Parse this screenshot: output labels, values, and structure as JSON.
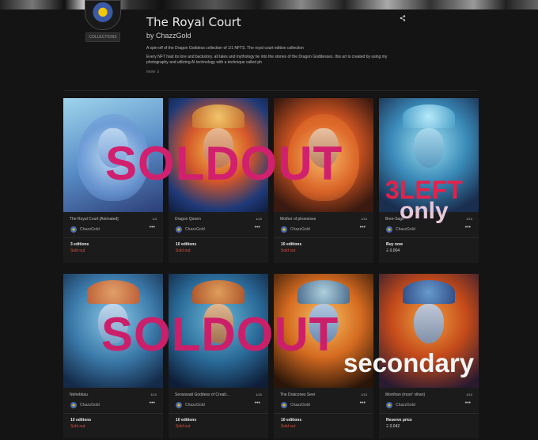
{
  "header": {
    "collections_label": "COLLECTIONS",
    "title": "The Royal Court",
    "byline": "by ChazzGold",
    "share_icon": "share-icon",
    "description_line1": "A spin-off of the Dragon Goddess collection of 1/1 NFTS. The royal court edition collection",
    "description_line2": "Every NFT hast its lore and backstory. all tales and mythology tie into the stories of the Dragon Goddesses. this art is created by using my photography and utilizing AI technology with a technique called ph",
    "more_label": "more ⇓"
  },
  "cards": [
    {
      "name": "The Royal Court [Animated]",
      "count": "1/3",
      "creator": "ChazzGold",
      "editions": "3 editions",
      "status": "Sold out",
      "status_kind": "sold"
    },
    {
      "name": "Dragon Queen",
      "count": "1/10",
      "creator": "ChazzGold",
      "editions": "10 editions",
      "status": "Sold out",
      "status_kind": "sold"
    },
    {
      "name": "Mother of phoenixes",
      "count": "1/10",
      "creator": "ChazzGold",
      "editions": "10 editions",
      "status": "Sold out",
      "status_kind": "sold"
    },
    {
      "name": "Bree-Sagh",
      "count": "1/10",
      "creator": "ChazzGold",
      "editions": "Buy now",
      "status": "Ξ 0.004",
      "status_kind": "price"
    },
    {
      "name": "Nehebkau",
      "count": "1/10",
      "creator": "ChazzGold",
      "editions": "10 editions",
      "status": "Sold out",
      "status_kind": "sold"
    },
    {
      "name": "Seosowati Goddess of Creati...",
      "count": "1/10",
      "creator": "ChazzGold",
      "editions": "10 editions",
      "status": "Sold out",
      "status_kind": "sold"
    },
    {
      "name": "The Draicones Seer",
      "count": "1/10",
      "creator": "ChazzGold",
      "editions": "10 editions",
      "status": "Sold out",
      "status_kind": "sold"
    },
    {
      "name": "Morrihan (moor' vihan)",
      "count": "1/10",
      "creator": "ChazzGold",
      "editions": "Reserve price",
      "status": "Ξ 0.042",
      "status_kind": "price"
    }
  ],
  "overlays": {
    "soldout_top": "SOLDOUT",
    "soldout_bottom": "SOLDOUT",
    "three_left": "3LEFT",
    "only": "only",
    "secondary": "secondary"
  },
  "colors": {
    "background": "#141414",
    "card": "#1b1b1b",
    "sold_out": "#e0503c",
    "overlay_magenta": "#d1206e",
    "overlay_red": "#e8204a"
  }
}
